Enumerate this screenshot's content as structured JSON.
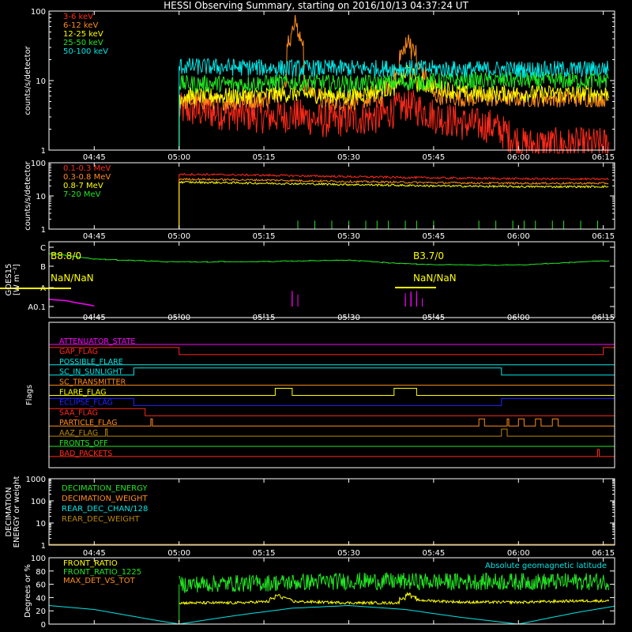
{
  "title": "HESSI Observing Summary, starting on 2016/10/13 04:37:24 UT",
  "colors": {
    "bg": "#000000",
    "axis": "#ffffff",
    "red": "#ff2a1a",
    "orange": "#ff8c1a",
    "yellow": "#ffff00",
    "green": "#22e622",
    "cyan": "#00e5e5",
    "magenta": "#ff00ff",
    "blue": "#2222ff",
    "brown": "#b8860b"
  },
  "chart_data": [
    {
      "type": "line",
      "ylabel": "counts/s/detector",
      "yscale": "log",
      "ylim": [
        1,
        100
      ],
      "xlim": [
        "04:37",
        "06:17"
      ],
      "xticks": [
        "04:45",
        "05:00",
        "05:15",
        "05:30",
        "05:45",
        "06:00",
        "06:15"
      ],
      "yticks": [
        "1",
        "10",
        "100"
      ],
      "legend": "top-left",
      "series": [
        {
          "name": "3-6 keV",
          "color": "red",
          "start": "05:00",
          "end": "06:16",
          "x": [
            "05:00",
            "05:05",
            "05:10",
            "05:15",
            "05:20",
            "05:25",
            "05:30",
            "05:35",
            "05:40",
            "05:45",
            "05:50",
            "05:55",
            "06:00",
            "06:05",
            "06:10",
            "06:16"
          ],
          "y": [
            3.8,
            3.5,
            3.3,
            3,
            3.2,
            2.6,
            2.8,
            3,
            4.5,
            3,
            2.4,
            2.2,
            1.2,
            1.2,
            1.2,
            1.2
          ]
        },
        {
          "name": "6-12 keV",
          "color": "orange",
          "start": "05:00",
          "end": "06:16",
          "x": [
            "05:00",
            "05:05",
            "05:10",
            "05:15",
            "05:18",
            "05:20",
            "05:22",
            "05:25",
            "05:30",
            "05:35",
            "05:38",
            "05:40",
            "05:42",
            "05:45",
            "05:50",
            "05:55",
            "06:00",
            "06:05",
            "06:10",
            "06:16"
          ],
          "y": [
            5,
            5,
            5,
            5.5,
            8,
            70,
            8,
            5,
            5,
            5.5,
            12,
            38,
            15,
            6,
            5.5,
            5.5,
            5.5,
            5.5,
            5.5,
            5.5
          ]
        },
        {
          "name": "12-25 keV",
          "color": "yellow",
          "start": "05:00",
          "end": "06:16",
          "x": [
            "05:00",
            "05:10",
            "05:20",
            "05:30",
            "05:38",
            "05:40",
            "05:42",
            "05:50",
            "06:00",
            "06:10",
            "06:16"
          ],
          "y": [
            6,
            6,
            6.5,
            6,
            8,
            14,
            9,
            6.5,
            6.5,
            6.5,
            6.5
          ]
        },
        {
          "name": "25-50 keV",
          "color": "green",
          "start": "05:00",
          "end": "06:16",
          "x": [
            "05:00",
            "05:10",
            "05:20",
            "05:30",
            "05:40",
            "05:50",
            "06:00",
            "06:10",
            "06:16"
          ],
          "y": [
            9,
            9,
            9.5,
            9,
            9.5,
            10,
            10,
            10,
            10
          ]
        },
        {
          "name": "50-100 keV",
          "color": "cyan",
          "start": "05:00",
          "end": "06:16",
          "x": [
            "05:00",
            "05:10",
            "05:20",
            "05:30",
            "05:40",
            "05:50",
            "06:00",
            "06:10",
            "06:16"
          ],
          "y": [
            16,
            15.5,
            15,
            15,
            15,
            14.5,
            14.5,
            14.5,
            15
          ]
        }
      ]
    },
    {
      "type": "line",
      "ylabel": "counts/s/detector",
      "yscale": "log",
      "ylim": [
        1,
        100
      ],
      "xlim": [
        "04:37",
        "06:17"
      ],
      "xticks": [
        "04:45",
        "05:00",
        "05:15",
        "05:30",
        "05:45",
        "06:00",
        "06:15"
      ],
      "yticks": [
        "1",
        "10",
        "100"
      ],
      "legend": "top-left",
      "series": [
        {
          "name": "0.1-0.3 MeV",
          "color": "red",
          "start": "05:00",
          "end": "06:16",
          "x": [
            "05:00",
            "05:15",
            "05:30",
            "05:45",
            "06:00",
            "06:16"
          ],
          "y": [
            45,
            42,
            38,
            35,
            33,
            32
          ]
        },
        {
          "name": "0.3-0.8 MeV",
          "color": "orange",
          "start": "05:00",
          "end": "06:16",
          "x": [
            "05:00",
            "05:15",
            "05:30",
            "05:45",
            "06:00",
            "06:16"
          ],
          "y": [
            32,
            30,
            27,
            25,
            24,
            24
          ]
        },
        {
          "name": "0.8-7 MeV",
          "color": "yellow",
          "start": "05:00",
          "end": "06:16",
          "x": [
            "05:00",
            "05:15",
            "05:30",
            "05:45",
            "06:00",
            "06:16"
          ],
          "y": [
            26,
            24,
            22,
            20,
            19,
            19
          ]
        },
        {
          "name": "7-20 MeV",
          "color": "green",
          "start": "05:00",
          "end": "06:16",
          "x": [
            "05:00",
            "05:30",
            "06:00",
            "06:16"
          ],
          "y": [
            1,
            1,
            1,
            1
          ],
          "spikes": [
            "05:21",
            "05:24",
            "05:27",
            "05:30",
            "05:33",
            "05:35",
            "05:37",
            "05:40",
            "05:42",
            "05:45",
            "05:53",
            "05:56",
            "05:59",
            "06:01",
            "06:03",
            "06:06",
            "06:08",
            "06:11",
            "06:14"
          ]
        }
      ]
    },
    {
      "type": "line",
      "ylabel": "GOES15",
      "ylabel2": "[W m⁻²]",
      "yscale": "log",
      "yticks": [
        "C",
        "B",
        "A",
        "A0.1"
      ],
      "xlim": [
        "04:37",
        "06:17"
      ],
      "xticks": [
        "04:45",
        "05:00",
        "05:15",
        "05:30",
        "05:45",
        "06:00",
        "06:15"
      ],
      "annotations": [
        "B8.8/0",
        "B3.7/0",
        "NaN/NaN",
        "NaN/NaN"
      ],
      "series": [
        {
          "name": "GOES long",
          "color": "green",
          "x": [
            "04:37",
            "04:45",
            "05:00",
            "05:15",
            "05:30",
            "05:40",
            "05:50",
            "06:00",
            "06:17"
          ],
          "y": [
            9.0,
            8.0,
            7.5,
            7.6,
            7.8,
            7.2,
            7.0,
            7.0,
            7.8
          ]
        },
        {
          "name": "GOES short",
          "color": "magenta",
          "x": [
            "04:37",
            "04:40",
            "04:42",
            "04:44",
            "04:45"
          ],
          "y": [
            1.2,
            1.0,
            0.6,
            0.3,
            0.1
          ],
          "bursts": [
            [
              "05:20",
              "05:21"
            ],
            [
              "05:40",
              "05:43"
            ]
          ]
        }
      ]
    },
    {
      "type": "table",
      "ylabel": "Flags",
      "xlim": [
        "04:37",
        "06:17"
      ],
      "flags": [
        {
          "name": "ATTENUATOR_STATE",
          "color": "magenta",
          "on": []
        },
        {
          "name": "GAP_FLAG",
          "color": "red",
          "on": [
            [
              "04:37",
              "05:00"
            ],
            [
              "06:15",
              "06:17"
            ]
          ]
        },
        {
          "name": "POSSIBLE_FLARE",
          "color": "cyan",
          "on": []
        },
        {
          "name": "SC_IN_SUNLIGHT",
          "color": "cyan",
          "on": [
            [
              "04:52",
              "05:57"
            ]
          ]
        },
        {
          "name": "SC_TRANSMITTER",
          "color": "orange",
          "on": []
        },
        {
          "name": "FLARE_FLAG",
          "color": "yellow",
          "on": [
            [
              "05:17",
              "05:20"
            ],
            [
              "05:38",
              "05:42"
            ]
          ]
        },
        {
          "name": "ECLIPSE_FLAG",
          "color": "blue",
          "on": [
            [
              "04:37",
              "04:52"
            ],
            [
              "05:57",
              "06:17"
            ]
          ]
        },
        {
          "name": "SAA_FLAG",
          "color": "red",
          "on": [
            [
              "04:37",
              "04:54"
            ]
          ]
        },
        {
          "name": "PARTICLE_FLAG",
          "color": "orange",
          "on": [
            [
              "04:55",
              "04:55"
            ],
            [
              "05:53",
              "05:54"
            ],
            [
              "05:58",
              "05:58"
            ],
            [
              "06:00",
              "06:01"
            ],
            [
              "06:03",
              "06:04"
            ],
            [
              "06:06",
              "06:07"
            ]
          ]
        },
        {
          "name": "AAZ_FLAG",
          "color": "brown",
          "on": [
            [
              "04:47",
              "04:47"
            ],
            [
              "05:57",
              "05:58"
            ]
          ]
        },
        {
          "name": "FRONTS_OFF",
          "color": "green",
          "on": []
        },
        {
          "name": "BAD_PACKETS",
          "color": "red",
          "on": [
            [
              "06:14",
              "06:14"
            ]
          ]
        }
      ]
    },
    {
      "type": "line",
      "ylabel": "DECIMATION",
      "ylabel2": "ENERGY or weight",
      "yscale": "log",
      "ylim": [
        1,
        1000
      ],
      "yticks": [
        "1",
        "10",
        "100",
        "1000"
      ],
      "xlim": [
        "04:37",
        "06:17"
      ],
      "xticks": [
        "04:45",
        "05:00",
        "05:15",
        "05:30",
        "05:45",
        "06:00",
        "06:15"
      ],
      "legend": "top-left",
      "series": [
        {
          "name": "DECIMATION_ENERGY",
          "color": "green",
          "x": [],
          "y": []
        },
        {
          "name": "DECIMATION_WEIGHT",
          "color": "orange",
          "x": [],
          "y": []
        },
        {
          "name": "REAR_DEC_CHAN/128",
          "color": "cyan",
          "x": [],
          "y": []
        },
        {
          "name": "REAR_DEC_WEIGHT",
          "color": "brown",
          "x": [],
          "y": []
        }
      ]
    },
    {
      "type": "line",
      "ylabel": "Degrees or %",
      "ylim": [
        0,
        100
      ],
      "yticks": [
        "0",
        "20",
        "40",
        "60",
        "80",
        "100"
      ],
      "xlim": [
        "04:37",
        "06:17"
      ],
      "xticks": [
        "04:45",
        "05:00",
        "05:15",
        "05:30",
        "05:45",
        "06:00",
        "06:15"
      ],
      "legend": "top-left",
      "series": [
        {
          "name": "FRONT_RATIO",
          "color": "yellow",
          "start": "05:00",
          "end": "06:16",
          "x": [
            "05:00",
            "05:10",
            "05:15",
            "05:17",
            "05:20",
            "05:30",
            "05:38",
            "05:40",
            "05:42",
            "05:50",
            "06:00",
            "06:10",
            "06:16"
          ],
          "y": [
            32,
            32,
            34,
            43,
            34,
            32,
            32,
            45,
            36,
            33,
            33,
            35,
            35
          ]
        },
        {
          "name": "FRONT_RATIO_1225",
          "color": "green",
          "start": "05:00",
          "end": "06:16",
          "x": [
            "05:00",
            "05:15",
            "05:30",
            "05:45",
            "06:00",
            "06:16"
          ],
          "y": [
            60,
            62,
            65,
            64,
            64,
            64
          ]
        },
        {
          "name": "MAX_DET_VS_TOT",
          "color": "orange",
          "x": [],
          "y": []
        },
        {
          "name": "Absolute geomagnetic latitude",
          "color": "cyan",
          "x": [
            "04:37",
            "04:45",
            "04:55",
            "05:00",
            "05:10",
            "05:20",
            "05:30",
            "05:40",
            "05:50",
            "06:00",
            "06:10",
            "06:17"
          ],
          "y": [
            28,
            22,
            7,
            0,
            13,
            24,
            28,
            22,
            10,
            0,
            17,
            27
          ]
        }
      ]
    }
  ]
}
